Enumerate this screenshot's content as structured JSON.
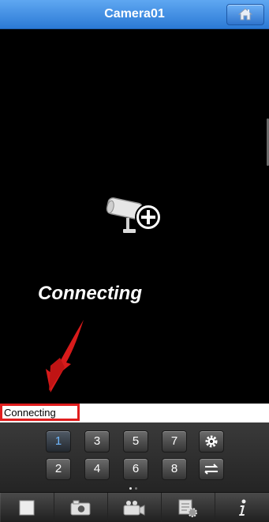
{
  "header": {
    "title": "Camera01",
    "home_icon": "home-icon"
  },
  "video": {
    "center_icon": "camera-add-icon",
    "overlay_text": "Connecting",
    "annotation_icon": "red-arrow-icon",
    "status_text": "Connecting"
  },
  "channels": [
    {
      "label": "1",
      "active": true
    },
    {
      "label": "3",
      "active": false
    },
    {
      "label": "5",
      "active": false
    },
    {
      "label": "7",
      "active": false
    },
    {
      "label": "2",
      "active": false
    },
    {
      "label": "4",
      "active": false
    },
    {
      "label": "6",
      "active": false
    },
    {
      "label": "8",
      "active": false
    }
  ],
  "controls": {
    "settings_icon": "gear-icon",
    "switch_icon": "swap-arrows-icon"
  },
  "page_indicator": {
    "current": 1,
    "total": 2
  },
  "toolbar": {
    "items": [
      "stop-icon",
      "camera-snapshot-icon",
      "video-record-icon",
      "playback-settings-icon",
      "info-icon"
    ]
  },
  "colors": {
    "header_blue": "#2b7ad6",
    "annotation_red": "#e01e1e",
    "active_channel": "#6fb8ff"
  }
}
